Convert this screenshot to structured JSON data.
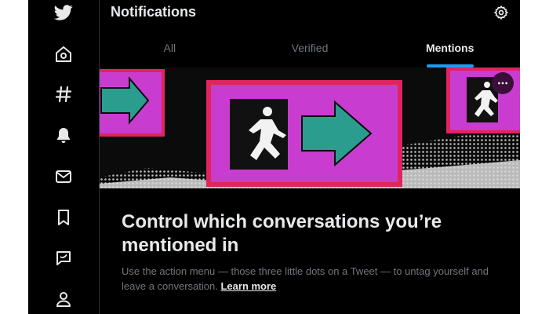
{
  "colors": {
    "background": "#000000",
    "accent": "#1d9bf0",
    "text_primary": "#e7e9ea",
    "text_secondary": "#71767b",
    "sign_magenta": "#c83ccf",
    "sign_border": "#e0245e",
    "arrow_teal": "#2a9d8f"
  },
  "sidebar": {
    "items": [
      {
        "icon": "twitter-bird-icon"
      },
      {
        "icon": "home-icon"
      },
      {
        "icon": "hashtag-icon"
      },
      {
        "icon": "bell-icon"
      },
      {
        "icon": "mail-icon"
      },
      {
        "icon": "bookmark-icon"
      },
      {
        "icon": "twitter-blue-icon"
      },
      {
        "icon": "profile-icon"
      }
    ]
  },
  "header": {
    "title": "Notifications",
    "settings_icon": "gear-icon"
  },
  "tabs": [
    {
      "label": "All",
      "active": false
    },
    {
      "label": "Verified",
      "active": false
    },
    {
      "label": "Mentions",
      "active": true
    }
  ],
  "prompt": {
    "headline": "Control which conversations you’re mentioned in",
    "body": "Use the action menu — those three little dots on a Tweet — to untag yourself and leave a conversation.",
    "link_label": "Learn more",
    "more_icon": "more-dots-icon"
  }
}
